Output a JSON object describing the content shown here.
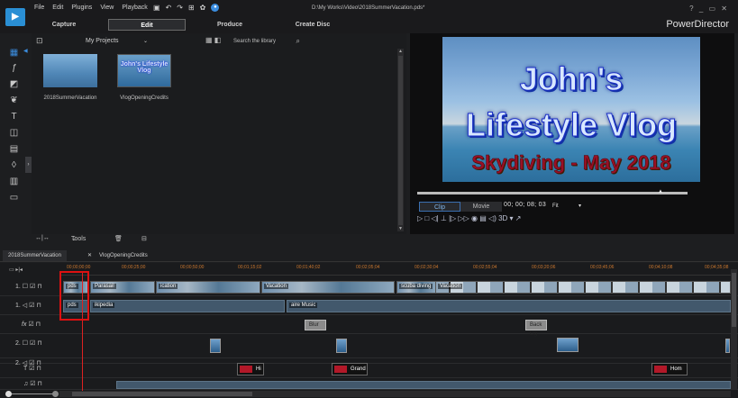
{
  "app": {
    "brand": "PowerDirector",
    "file_path": "D:\\My Works\\Video\\2018SummerVacation.pds*",
    "window_controls": "? _ ▭ ✕"
  },
  "menu": [
    "File",
    "Edit",
    "Plugins",
    "View",
    "Playback"
  ],
  "modes": [
    "Capture",
    "Edit",
    "Produce",
    "Create Disc"
  ],
  "library": {
    "dropdown": "My Projects",
    "search_placeholder": "Search the library",
    "items": [
      {
        "caption": "2018SummerVacation"
      },
      {
        "caption": "VlogOpeningCredits",
        "thumb_text": "John's Lifestyle Vlog"
      }
    ]
  },
  "preview": {
    "title_line1": "John's",
    "title_line2": "Lifestyle Vlog",
    "title_line3": "Skydiving - May 2018",
    "clip_label": "Clip",
    "movie_label": "Movie",
    "timecode": "00; 00; 08; 03",
    "fit_label": "Fit",
    "seek_position": 0.9,
    "controls": "▷ □ ◁| ⊥ |▷ ▷▷ ◉ ▤ ◁) 3D ▾ ↗"
  },
  "midbar": {
    "tools": "Tools"
  },
  "project_tabs": [
    "2018SummerVacation",
    "VlogOpeningCredits"
  ],
  "timeline": {
    "ticks": [
      "00;00;00;00",
      "00;00;25;00",
      "00;00;50;00",
      "00;01;15;02",
      "00;01;40;02",
      "00;02;05;04",
      "00;02;30;04",
      "00;02;55;04",
      "00;03;20;06",
      "00;03;45;06",
      "00;04;10;08",
      "00;04;35;08"
    ],
    "tracks": [
      {
        "name": "1.",
        "clips": [
          "pds",
          "Parasail",
          "ication",
          "Vacation",
          "scuba diving",
          "Vacation"
        ]
      },
      {
        "name": "1.",
        "clips": [
          "pds",
          "ikipedia",
          "aire Music"
        ]
      },
      {
        "name": "fx",
        "clips": [
          "Blur",
          "Back Lig"
        ]
      },
      {
        "name": "2.",
        "clips": []
      },
      {
        "name": "2.",
        "clips": []
      },
      {
        "name": "T",
        "clips": [
          "Hi",
          "Grand",
          "Hom"
        ]
      },
      {
        "name": "♫",
        "clips": []
      }
    ]
  }
}
